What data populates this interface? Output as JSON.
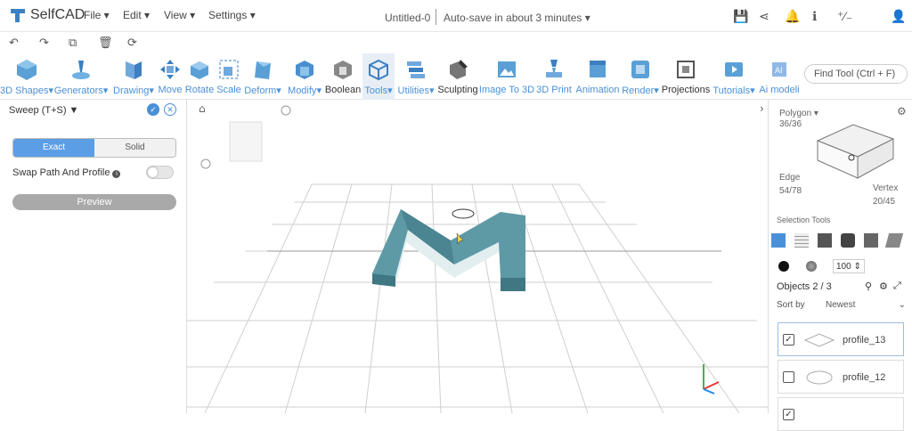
{
  "app": {
    "name": "SelfCAD"
  },
  "menu": [
    {
      "label": "File"
    },
    {
      "label": "Edit"
    },
    {
      "label": "View"
    },
    {
      "label": "Settings"
    }
  ],
  "document": {
    "title": "Untitled-0",
    "autosave": "Auto-save in about 3 minutes"
  },
  "toolbar": {
    "tools": [
      {
        "label": "3D Shapes"
      },
      {
        "label": "Generators"
      },
      {
        "label": "Drawing"
      },
      {
        "label": "Move"
      },
      {
        "label": "Rotate"
      },
      {
        "label": "Scale"
      },
      {
        "label": "Deform"
      },
      {
        "label": "Modify"
      },
      {
        "label": "Boolean"
      },
      {
        "label": "Tools"
      },
      {
        "label": "Utilities"
      },
      {
        "label": "Sculpting"
      },
      {
        "label": "Image To 3D"
      },
      {
        "label": "3D Print"
      },
      {
        "label": "Animation"
      },
      {
        "label": "Render"
      },
      {
        "label": "Projections"
      },
      {
        "label": "Tutorials"
      },
      {
        "label": "Ai modeli"
      }
    ],
    "find_placeholder": "Find Tool (Ctrl + F)"
  },
  "sweep_panel": {
    "title": "Sweep (T+S)",
    "mode_exact": "Exact",
    "mode_solid": "Solid",
    "swap_label": "Swap Path And Profile",
    "preview_label": "Preview"
  },
  "selection_panel": {
    "polygon_label": "Polygon",
    "polygon_count": "36/36",
    "edge_label": "Edge",
    "edge_count": "54/78",
    "vertex_label": "Vertex",
    "vertex_count": "20/45",
    "selection_tools_label": "Selection Tools",
    "opacity_value": "100"
  },
  "objects": {
    "header": "Objects 2 / 3",
    "sort_label": "Sort by",
    "sort_value": "Newest",
    "items": [
      {
        "name": "profile_13"
      },
      {
        "name": "profile_12"
      }
    ]
  },
  "colors": {
    "accent": "#4a90d9",
    "model": "#5d9aa6"
  }
}
